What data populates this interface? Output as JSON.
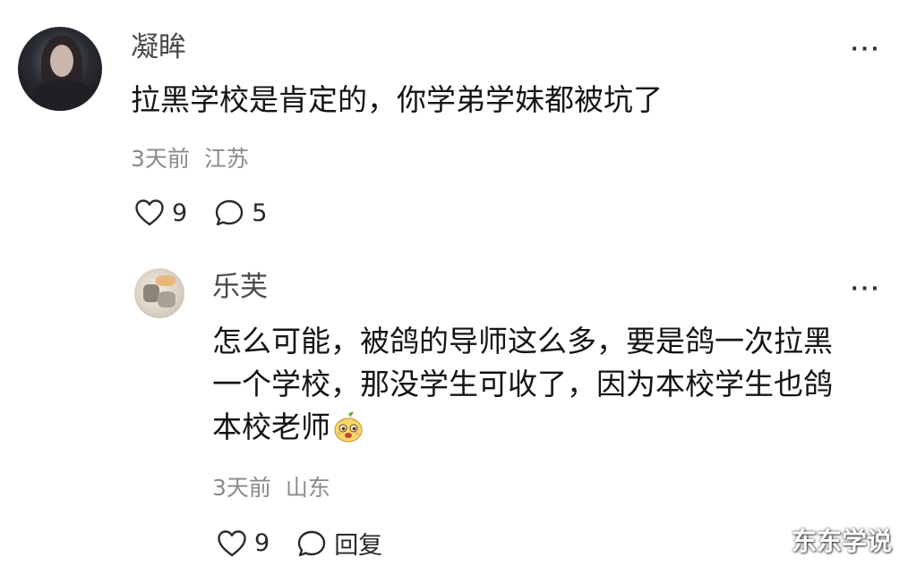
{
  "comment": {
    "username": "凝眸",
    "text": "拉黑学校是肯定的，你学弟学妹都被坑了",
    "time": "3天前",
    "location": "江苏",
    "likes": "9",
    "replies": "5",
    "icons": {
      "like": "heart-icon",
      "reply": "comment-bubble-icon",
      "more": "more-dots-icon"
    }
  },
  "reply": {
    "username": "乐芙",
    "text_line1": "怎么可能，被鸽的导师这么多，要是鸽一次拉黑",
    "text_line2": "一个学校，那没学生可收了，因为本校学生也鸽",
    "text_line3": "本校老师",
    "time": "3天前",
    "location": "山东",
    "likes": "9",
    "reply_label": "回复",
    "icons": {
      "emoji": "pear-face-emoji-icon",
      "like": "heart-icon",
      "reply": "comment-bubble-icon",
      "more": "more-dots-icon"
    }
  },
  "more_label": "···",
  "watermark": "东东学说"
}
